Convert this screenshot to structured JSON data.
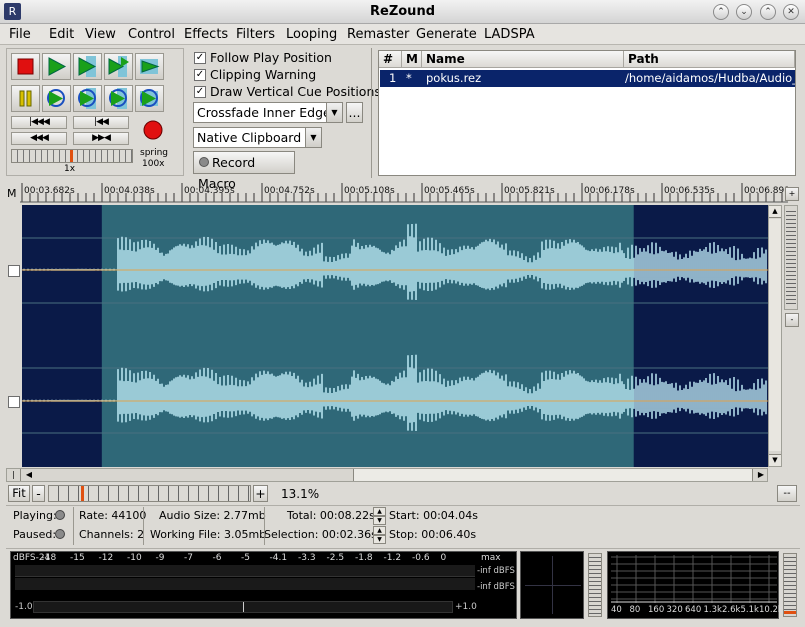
{
  "window": {
    "title": "ReZound",
    "icon": "rezound-app-icon",
    "buttons": [
      "scroll-up-icon",
      "minimize-icon",
      "maximize-icon",
      "close-icon"
    ]
  },
  "menu": [
    "File",
    "Edit",
    "View",
    "Control",
    "Effects",
    "Filters",
    "Looping",
    "Remaster",
    "Generate",
    "LADSPA"
  ],
  "transport": {
    "play_rate_label": "1x",
    "shuttle_mode": "spring",
    "shuttle_rate": "100x"
  },
  "options": {
    "follow_play_position": "Follow Play Position",
    "clipping_warning": "Clipping Warning",
    "draw_vertical_cue_positions": "Draw Vertical Cue Positions",
    "crossfade": "Crossfade Inner Edges",
    "crossfade_more": "...",
    "clipboard": "Native Clipboard 1",
    "record_macro": "Record Macro"
  },
  "file_list": {
    "columns": [
      "#",
      "M",
      "Name",
      "Path"
    ],
    "rows": [
      {
        "num": "1",
        "modified": "*",
        "name": "pokus.rez",
        "path": "/home/aidamos/Hudba/Audio_proje"
      }
    ]
  },
  "ruler": {
    "marker_label": "M",
    "ticks": [
      "00:03.682s",
      "00:04.038s",
      "00:04.395s",
      "00:04.752s",
      "00:05.108s",
      "00:05.465s",
      "00:05.821s",
      "00:06.178s",
      "00:06.535s",
      "00:06.891"
    ]
  },
  "selection_fraction": {
    "start": 0.107,
    "stop": 0.82
  },
  "zoom": {
    "fit_label": "Fit",
    "minus": "-",
    "plus": "+",
    "percent": "13.1%",
    "collapse": "--"
  },
  "status": {
    "playing_label": "Playing:",
    "paused_label": "Paused:",
    "rate": "Rate: 44100",
    "channels": "Channels: 2",
    "audio_size": "Audio Size:  2.77mb",
    "working_file": "Working File:  3.05mb",
    "total": "Total:  00:08.22s",
    "selection": "Selection:  00:02.36s",
    "start": "Start:  00:04.04s",
    "stop": "Stop:  00:06.40s"
  },
  "meters": {
    "scale": [
      "dBFS-24",
      "-18",
      "-15",
      "-12",
      "-10",
      "-9",
      "-7",
      "-6",
      "-5",
      "-4.1",
      "-3.3",
      "-2.5",
      "-1.8",
      "-1.2",
      "-0.6",
      "0",
      "max"
    ],
    "ch1_peak": "-inf dBFS",
    "ch2_peak": "-inf dBFS",
    "balance_min": "-1.0",
    "balance_max": "+1.0",
    "analyzer_bands": [
      "40",
      "80",
      "160",
      "320",
      "640",
      "1.3k",
      "2.6k",
      "5.1k",
      "10.2k"
    ]
  },
  "colors": {
    "waveform_bg": "#0a1a48",
    "selection_bg": "#2f6878",
    "waveform": "#c8f4ff",
    "selected_row": "#0a246a",
    "stop_button": "#e01010",
    "play_button": "#1aa01a"
  }
}
